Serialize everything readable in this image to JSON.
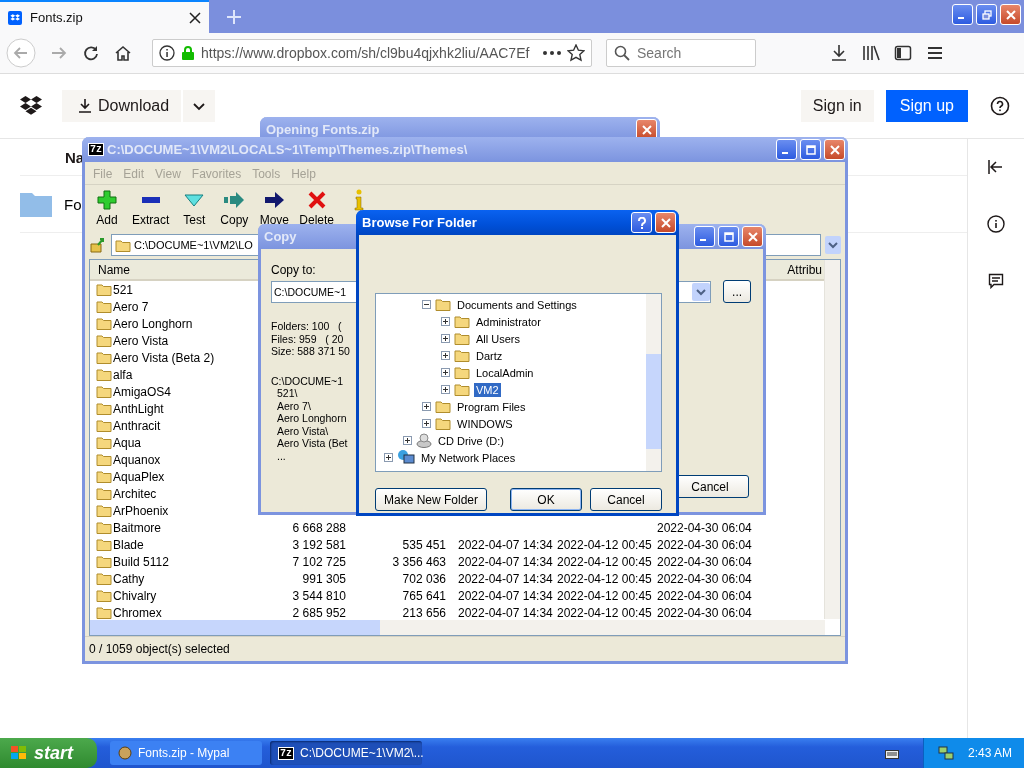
{
  "browser": {
    "tab": {
      "title": "Fonts.zip"
    },
    "url": "https://www.dropbox.com/sh/cl9bu4qjxhk2liu/AAC7Ef",
    "search": {
      "placeholder": "Search"
    }
  },
  "page": {
    "download_button": "Download",
    "sign_in_button": "Sign in",
    "sign_up_button": "Sign up",
    "column_header": "Na",
    "folder_name": "Fo"
  },
  "opening_dialog": {
    "title": "Opening Fonts.zip"
  },
  "archive_window": {
    "app_badge": "7z",
    "title": "C:\\DOCUME~1\\VM2\\LOCALS~1\\Temp\\Themes.zip\\Themes\\",
    "menu": [
      {
        "label": "File",
        "disabled": true
      },
      {
        "label": "Edit",
        "disabled": true
      },
      {
        "label": "View",
        "disabled": true
      },
      {
        "label": "Favorites",
        "disabled": true
      },
      {
        "label": "Tools",
        "disabled": true
      },
      {
        "label": "Help",
        "disabled": true
      }
    ],
    "toolbar": [
      {
        "kind": "add",
        "label": "Add"
      },
      {
        "kind": "extract",
        "label": "Extract"
      },
      {
        "kind": "test",
        "label": "Test"
      },
      {
        "kind": "copy",
        "label": "Copy"
      },
      {
        "kind": "move",
        "label": "Move"
      },
      {
        "kind": "delete",
        "label": "Delete"
      },
      {
        "kind": "info"
      }
    ],
    "address": "C:\\DOCUME~1\\VM2\\LO",
    "columns": {
      "name": "Name",
      "attributes": "Attribu"
    },
    "rows": [
      {
        "name": "521"
      },
      {
        "name": "Aero 7"
      },
      {
        "name": "Aero Longhorn"
      },
      {
        "name": "Aero Vista"
      },
      {
        "name": "Aero Vista (Beta 2)"
      },
      {
        "name": "alfa"
      },
      {
        "name": "AmigaOS4"
      },
      {
        "name": "AnthLight"
      },
      {
        "name": "Anthracit"
      },
      {
        "name": "Aqua"
      },
      {
        "name": "Aquanox"
      },
      {
        "name": "AquaPlex"
      },
      {
        "name": "Architec"
      },
      {
        "name": "ArPhoenix"
      },
      {
        "name": "Baitmore",
        "size": "6 668 288",
        "accessed": "2022-04-30 06:04"
      },
      {
        "name": "Blade",
        "size": "3 192 581",
        "packed": "535 451",
        "modified": "2022-04-07 14:34",
        "created": "2022-04-12 00:45",
        "accessed": "2022-04-30 06:04"
      },
      {
        "name": "Build 5112",
        "size": "7 102 725",
        "packed": "3 356 463",
        "modified": "2022-04-07 14:34",
        "created": "2022-04-12 00:45",
        "accessed": "2022-04-30 06:04"
      },
      {
        "name": "Cathy",
        "size": "991 305",
        "packed": "702 036",
        "modified": "2022-04-07 14:34",
        "created": "2022-04-12 00:45",
        "accessed": "2022-04-30 06:04"
      },
      {
        "name": "Chivalry",
        "size": "3 544 810",
        "packed": "765 641",
        "modified": "2022-04-07 14:34",
        "created": "2022-04-12 00:45",
        "accessed": "2022-04-30 06:04"
      },
      {
        "name": "Chromex",
        "size": "2 685 952",
        "packed": "213 656",
        "modified": "2022-04-07 14:34",
        "created": "2022-04-12 00:45",
        "accessed": "2022-04-30 06:04"
      }
    ],
    "status": "0 / 1059 object(s) selected"
  },
  "copy_dialog": {
    "title": "Copy",
    "copy_to_label": "Copy to:",
    "path_field": "C:\\DOCUME~1",
    "summary": [
      "Folders: 100   (",
      "Files: 959   ( 20",
      "Size: 588 371 50"
    ],
    "root": "C:\\DOCUME~1",
    "entries": [
      "521\\",
      "Aero 7\\",
      "Aero Longhorn",
      "Aero Vista\\",
      "Aero Vista (Bet",
      "..."
    ],
    "browse_button": "...",
    "cancel_button": "Cancel"
  },
  "browse_dialog": {
    "title": "Browse For Folder",
    "tree": [
      {
        "children": [
          {
            "children": [
              {
                "label": "Documents and Settings",
                "kind": "folder",
                "expanded": true,
                "selected": false,
                "children": [
                  {
                    "label": "Administrator",
                    "kind": "folder",
                    "expanded": false,
                    "selected": false
                  },
                  {
                    "label": "All Users",
                    "kind": "folder",
                    "expanded": false,
                    "selected": false
                  },
                  {
                    "label": "Dartz",
                    "kind": "folder",
                    "expanded": false,
                    "selected": false
                  },
                  {
                    "label": "LocalAdmin",
                    "kind": "folder",
                    "expanded": false,
                    "selected": false
                  },
                  {
                    "label": "VM2",
                    "kind": "folder",
                    "expanded": false,
                    "selected": true
                  }
                ]
              },
              {
                "label": "Program Files",
                "kind": "folder",
                "expanded": false,
                "selected": false
              },
              {
                "label": "WINDOWS",
                "kind": "folder",
                "expanded": false,
                "selected": false
              }
            ]
          },
          {
            "label": "CD Drive (D:)",
            "kind": "drive",
            "expanded": false,
            "selected": false
          }
        ]
      },
      {
        "label": "My Network Places",
        "kind": "network",
        "expanded": false,
        "selected": false
      }
    ],
    "new_folder_button": "Make New Folder",
    "ok_button": "OK",
    "cancel_button": "Cancel"
  },
  "taskbar": {
    "start": "start",
    "tasks": [
      {
        "kind": "browser",
        "label": "Fonts.zip - Mypal",
        "selected": false
      },
      {
        "kind": "archive",
        "badge": "7z",
        "label": "C:\\DOCUME~1\\VM2\\...",
        "selected": true
      }
    ],
    "clock": "2:43 AM"
  }
}
